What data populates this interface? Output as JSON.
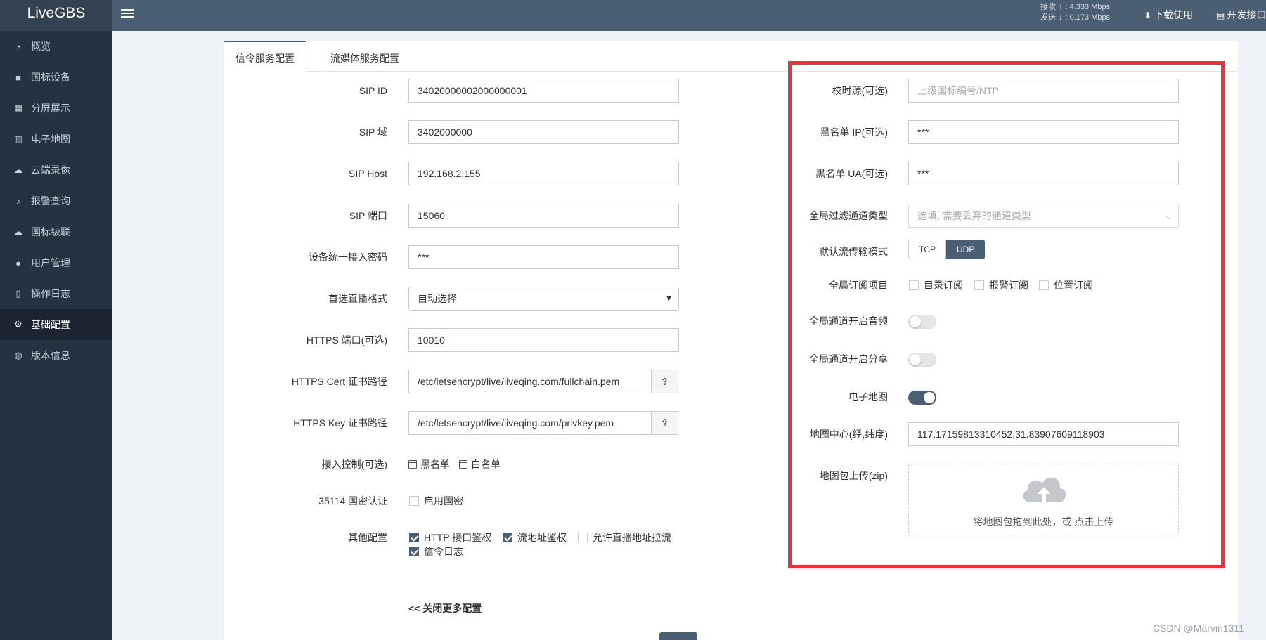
{
  "topbar": {
    "brand": "LiveGBS",
    "speed": {
      "recv_label": "接收",
      "recv_value": "4.333 Mbps",
      "send_label": "发送",
      "send_value": "0.173 Mbps"
    },
    "download_label": "下载使用",
    "dev_label": "开发接口"
  },
  "sidebar": {
    "items": [
      {
        "label": "概览",
        "icon": "dashboard-icon"
      },
      {
        "label": "国标设备",
        "icon": "video-camera-icon"
      },
      {
        "label": "分屏展示",
        "icon": "grid-icon"
      },
      {
        "label": "电子地图",
        "icon": "map-icon"
      },
      {
        "label": "云端录像",
        "icon": "cloud-icon"
      },
      {
        "label": "报警查询",
        "icon": "bell-icon"
      },
      {
        "label": "国标级联",
        "icon": "cloud-upload-icon"
      },
      {
        "label": "用户管理",
        "icon": "users-icon"
      },
      {
        "label": "操作日志",
        "icon": "file-icon"
      },
      {
        "label": "基础配置",
        "icon": "cogs-icon"
      },
      {
        "label": "版本信息",
        "icon": "globe-icon"
      }
    ]
  },
  "tabs": [
    "信令服务配置",
    "流媒体服务配置"
  ],
  "left_form": {
    "sip_id": {
      "label": "SIP ID",
      "value": "34020000002000000001"
    },
    "sip_domain": {
      "label": "SIP 域",
      "value": "3402000000"
    },
    "sip_host": {
      "label": "SIP Host",
      "value": "192.168.2.155"
    },
    "sip_port": {
      "label": "SIP 端口",
      "value": "15060"
    },
    "device_password": {
      "label": "设备统一接入密码",
      "value": "***"
    },
    "preferred_format": {
      "label": "首选直播格式",
      "value": "自动选择"
    },
    "https_port": {
      "label": "HTTPS 端口(可选)",
      "value": "10010"
    },
    "https_cert": {
      "label": "HTTPS Cert 证书路径",
      "value": "/etc/letsencrypt/live/liveqing.com/fullchain.pem"
    },
    "https_key": {
      "label": "HTTPS Key 证书路径",
      "value": "/etc/letsencrypt/live/liveqing.com/privkey.pem"
    },
    "access_control": {
      "label": "接入控制(可选)",
      "blacklist": "黑名单",
      "whitelist": "白名单"
    },
    "gm_auth": {
      "label": "35114 国密认证",
      "option": "启用国密"
    },
    "other": {
      "label": "其他配置",
      "options": [
        "HTTP 接口鉴权",
        "流地址鉴权",
        "允许直播地址拉流",
        "信令日志"
      ]
    },
    "close_more": "<<  关闭更多配置"
  },
  "right_form": {
    "time_source": {
      "label": "校时源(可选)",
      "placeholder": "上级国标编号/NTP"
    },
    "blacklist_ip": {
      "label": "黑名单 IP(可选)",
      "value": "***"
    },
    "blacklist_ua": {
      "label": "黑名单 UA(可选)",
      "value": "***"
    },
    "filter_channel": {
      "label": "全局过滤通道类型",
      "placeholder": "选填, 需要丢弃的通道类型"
    },
    "transport_mode": {
      "label": "默认流传输模式",
      "options": [
        "TCP",
        "UDP"
      ],
      "selected": "UDP"
    },
    "subscribe": {
      "label": "全局订阅项目",
      "options": [
        "目录订阅",
        "报警订阅",
        "位置订阅"
      ]
    },
    "audio": {
      "label": "全局通道开启音频",
      "on": false
    },
    "share": {
      "label": "全局通道开启分享",
      "on": false
    },
    "emap": {
      "label": "电子地图",
      "on": true
    },
    "map_center": {
      "label": "地图中心(经,纬度)",
      "value": "117.17159813310452,31.83907609118903"
    },
    "map_upload": {
      "label": "地图包上传(zip)",
      "text": "将地图包拖到此处，或 点击上传"
    }
  },
  "colors": {
    "topbar": "#4b5f74",
    "sidebar": "#243241",
    "accent": "#4b5f74",
    "highlight_border": "#e8333b"
  },
  "watermark": "CSDN @Marvin1311"
}
